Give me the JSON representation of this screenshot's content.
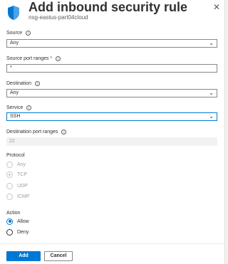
{
  "header": {
    "title": "Add inbound security rule",
    "subtitle": "nsg-eastus-part04cloud",
    "close_glyph": "✕",
    "icon": "shield-icon",
    "icon_color": "#0078d4"
  },
  "source": {
    "label": "Source",
    "value": "Any"
  },
  "source_port_ranges": {
    "label": "Source port ranges",
    "required": "*",
    "value": "*"
  },
  "destination": {
    "label": "Destination",
    "value": "Any"
  },
  "service": {
    "label": "Service",
    "value": "SSH"
  },
  "destination_port_ranges": {
    "label": "Destination port ranges",
    "value": "22"
  },
  "protocol": {
    "label": "Protocol",
    "options": [
      "Any",
      "TCP",
      "UDP",
      "ICMP"
    ],
    "selected": "TCP"
  },
  "action": {
    "label": "Action",
    "options": [
      "Allow",
      "Deny"
    ],
    "selected": "Allow"
  },
  "footer": {
    "add_label": "Add",
    "cancel_label": "Cancel"
  },
  "colors": {
    "accent": "#0078d4",
    "text": "#323130",
    "muted": "#a19f9d"
  }
}
